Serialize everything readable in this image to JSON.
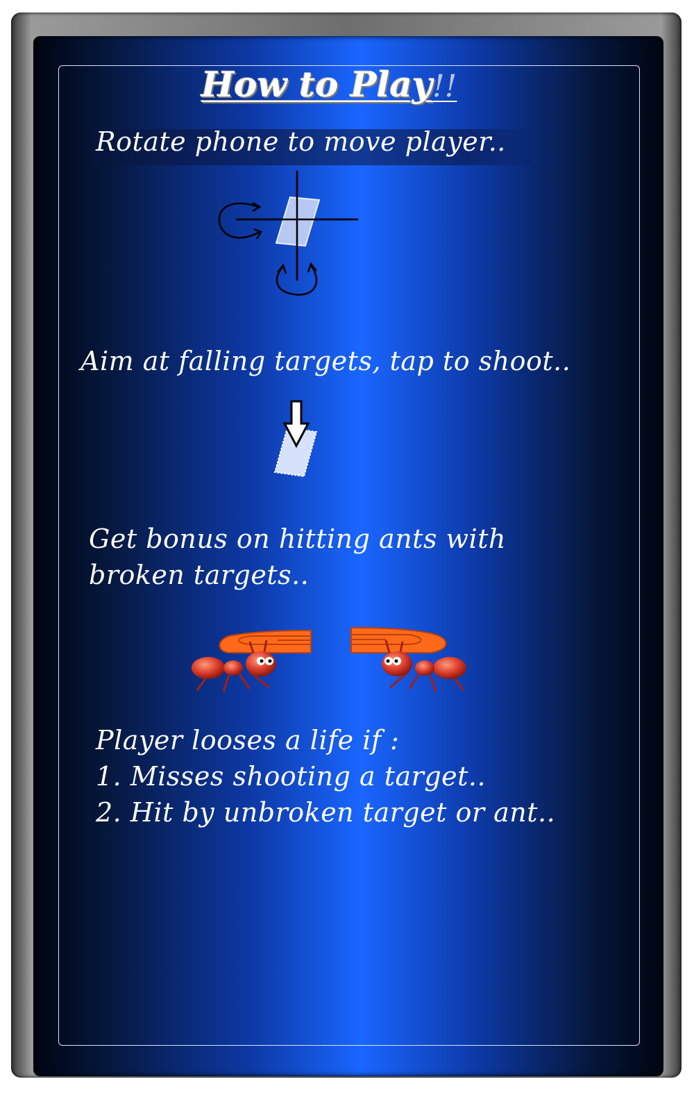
{
  "title": {
    "main": "How to Play",
    "suffix": "!!"
  },
  "instructions": {
    "rotate": "Rotate phone to move player..",
    "aim": "Aim at falling targets, tap to shoot..",
    "bonus_line1": "Get bonus on hitting ants with",
    "bonus_line2": "broken targets..",
    "life_heading": "Player looses a  life if :",
    "life_item1": "1. Misses shooting a target..",
    "life_item2": "2. Hit by unbroken target or ant.."
  },
  "icons": {
    "rotate_diagram": "phone-rotation-icon",
    "falling_target": "falling-target-arrow-icon",
    "ants": "ant-with-broken-target-icon"
  },
  "colors": {
    "screen_center": "#1a66ff",
    "screen_edge": "#000510",
    "text": "#ffffff",
    "target_orange": "#ff6a1a",
    "ant_red": "#d93a2a"
  }
}
